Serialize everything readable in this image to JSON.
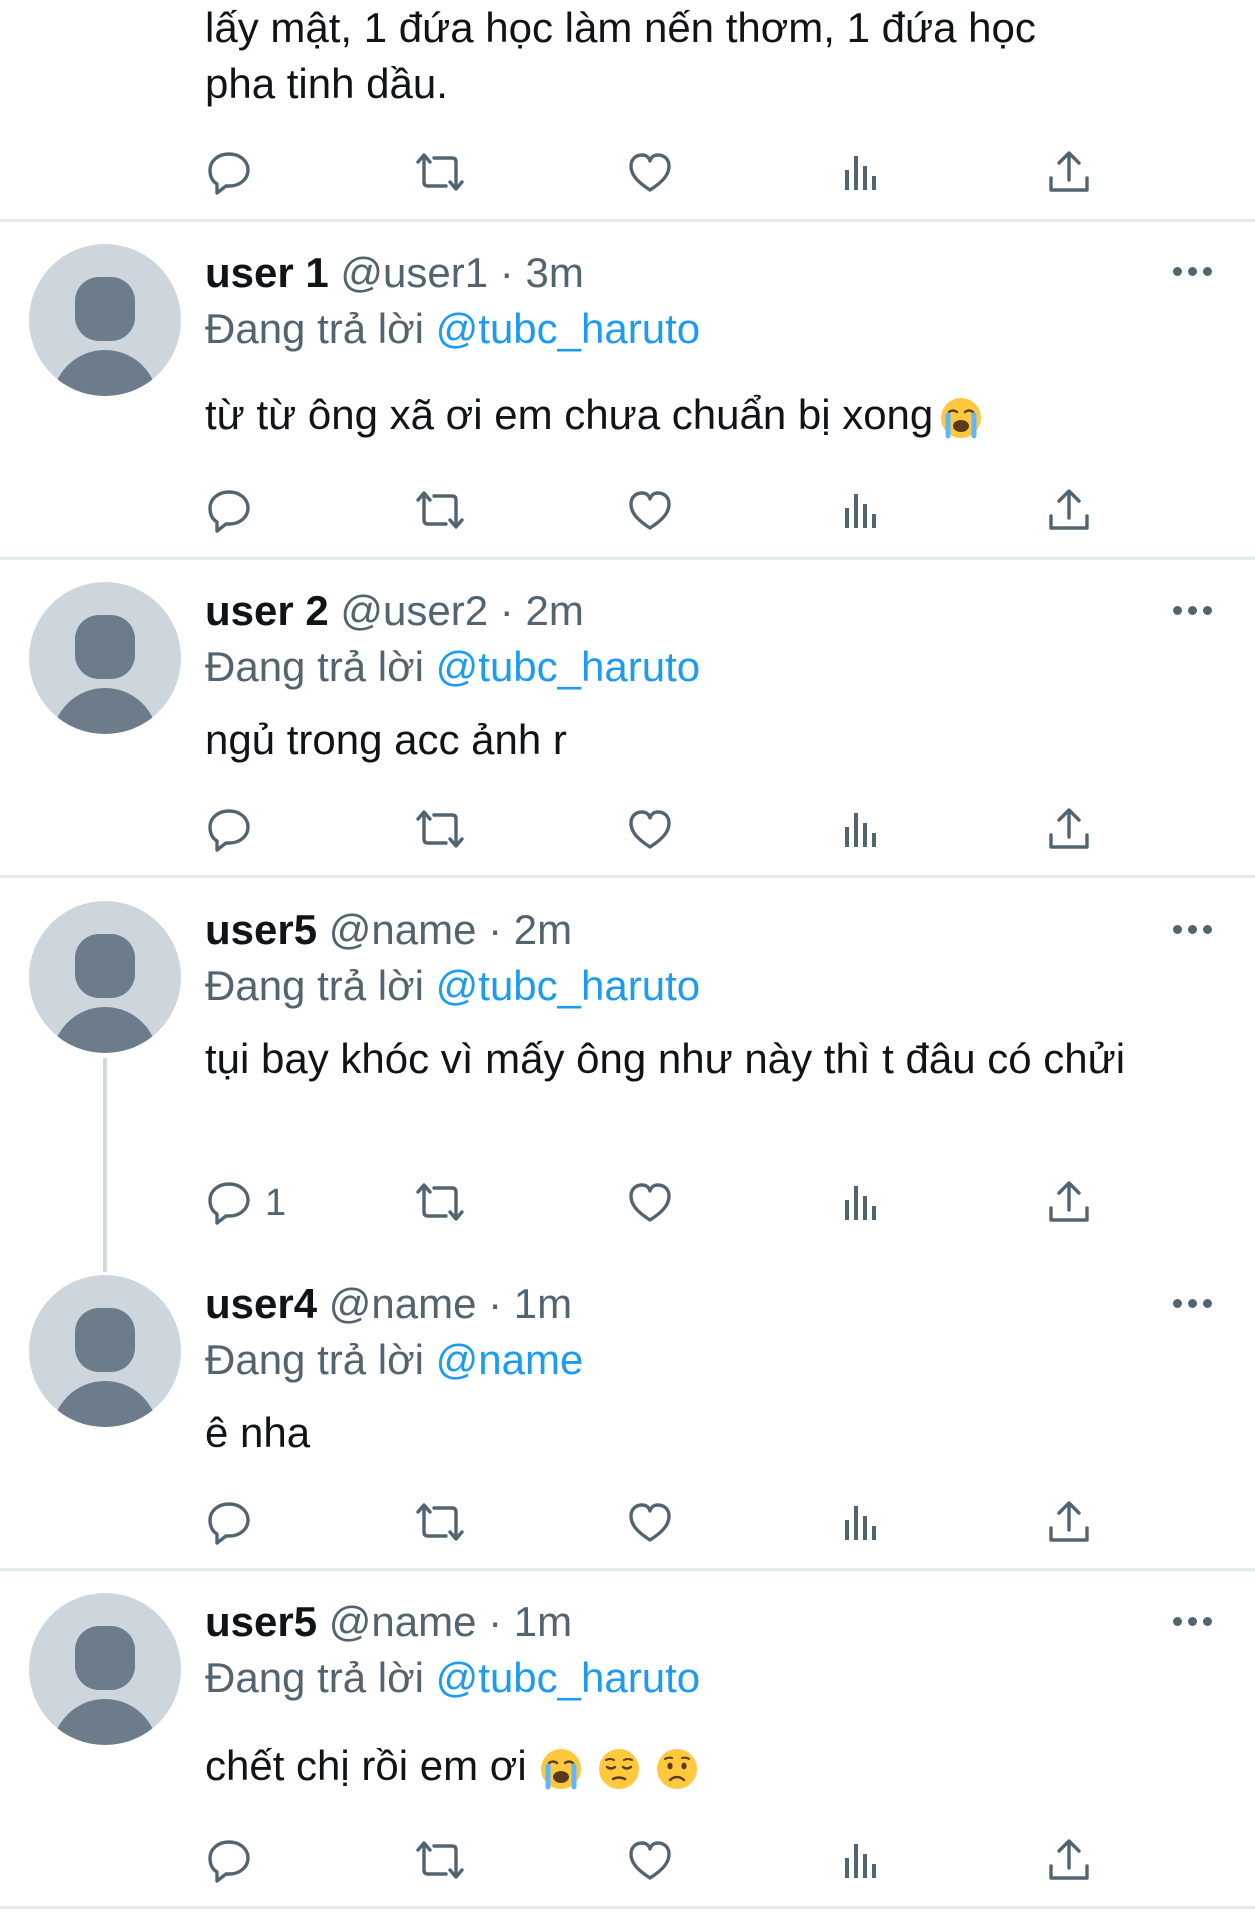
{
  "top_tweet": {
    "text_line1": "lấy mật, 1 đứa học làm nến thơm, 1 đứa học",
    "text_line2": "pha tinh dầu."
  },
  "replies": [
    {
      "name": "user 1",
      "handle": "@user1",
      "dot": "·",
      "time": "3m",
      "reply_prefix": "Đang trả lời",
      "reply_to": "@tubc_haruto",
      "text": "từ từ ông xã ơi em chưa chuẩn bị xong",
      "emojis": [
        "loudly-crying-face"
      ]
    },
    {
      "name": "user 2",
      "handle": "@user2",
      "dot": "·",
      "time": "2m",
      "reply_prefix": "Đang trả lời",
      "reply_to": "@tubc_haruto",
      "text": "ngủ trong acc ảnh r"
    },
    {
      "name": "user5",
      "handle": "@name",
      "dot": "·",
      "time": "2m",
      "reply_prefix": "Đang trả lời",
      "reply_to": "@tubc_haruto",
      "text": "tụi bay khóc vì mấy ông như này thì t đâu có chửi",
      "reply_count": "1"
    },
    {
      "name": "user4",
      "handle": "@name",
      "dot": "·",
      "time": "1m",
      "reply_prefix": "Đang trả lời",
      "reply_to": "@name",
      "text": "ê nha"
    },
    {
      "name": "user5",
      "handle": "@name",
      "dot": "·",
      "time": "1m",
      "reply_prefix": "Đang trả lời",
      "reply_to": "@tubc_haruto",
      "text": "chết chị rồi em ơi",
      "emojis": [
        "loudly-crying-face",
        "pensive-face",
        "worried-face"
      ]
    }
  ],
  "icons": [
    "reply-icon",
    "retweet-icon",
    "like-icon",
    "views-icon",
    "share-icon",
    "more-icon"
  ],
  "colors": {
    "accent": "#1d9bf0",
    "text": "#0f1419",
    "secondary": "#536471",
    "divider": "#e6ecf0",
    "avatar_bg": "#cdd6dd",
    "avatar_fg": "#6c7c8b"
  }
}
